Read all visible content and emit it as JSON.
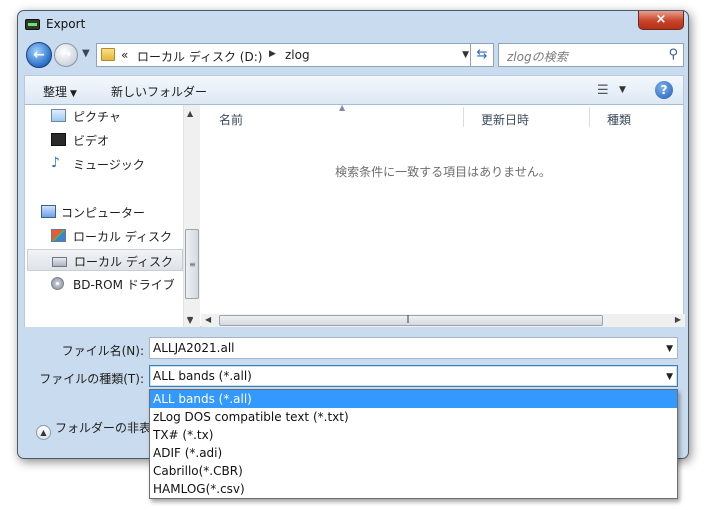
{
  "window": {
    "title": "Export",
    "close_label": "×"
  },
  "address": {
    "overflow": "«",
    "crumb_1": "ローカル ディスク (D:)",
    "crumb_2": "zlog",
    "search_placeholder": "zlogの検索"
  },
  "toolbar": {
    "organize_label": "整理",
    "new_folder_label": "新しいフォルダー",
    "help_label": "?"
  },
  "nav_pane": {
    "items": [
      {
        "label": "ピクチャ",
        "icon": "pictures-icon"
      },
      {
        "label": "ビデオ",
        "icon": "video-icon"
      },
      {
        "label": "ミュージック",
        "icon": "music-icon"
      },
      {
        "label": "コンピューター",
        "icon": "computer-icon"
      },
      {
        "label": "ローカル ディスク",
        "icon": "windows-disk-icon"
      },
      {
        "label": "ローカル ディスク",
        "icon": "disk-drive-icon",
        "selected": true
      },
      {
        "label": "BD-ROM ドライブ",
        "icon": "optical-drive-icon"
      }
    ]
  },
  "file_list": {
    "columns": [
      "名前",
      "更新日時",
      "種類"
    ],
    "empty_message": "検索条件に一致する項目はありません。"
  },
  "form": {
    "filename_label": "ファイル名(N):",
    "filename_value": "ALLJA2021.all",
    "filetype_label": "ファイルの種類(T):",
    "filetype_value": "ALL bands (*.all)",
    "hide_folders_label": "フォルダーの非表示"
  },
  "filetype_options": [
    "ALL bands (*.all)",
    "zLog DOS compatible text (*.txt)",
    "TX# (*.tx)",
    "ADIF (*.adi)",
    "Cabrillo(*.CBR)",
    "HAMLOG(*.csv)"
  ],
  "colors": {
    "selection": "#3399ff",
    "window_frame": "#c9dbee",
    "close_button": "#c7432a"
  }
}
